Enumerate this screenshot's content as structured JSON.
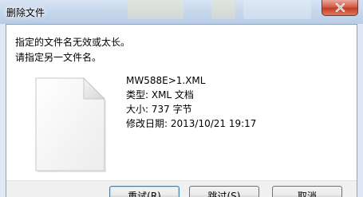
{
  "window": {
    "title": "删除文件",
    "close_icon": "close-icon"
  },
  "message": {
    "line1": "指定的文件名无效或太长。",
    "line2": "请指定另一文件名。"
  },
  "file": {
    "icon": "document-icon",
    "name": "MW588E>1.XML",
    "type": "类型: XML 文档",
    "size": "大小: 737 字节",
    "modified": "修改日期: 2013/10/21 19:17"
  },
  "buttons": {
    "retry": "重试(R)",
    "skip": "跳过(S)",
    "cancel": "取消"
  },
  "colors": {
    "close_button": "#c23a24",
    "titlebar": "#c8d8ec",
    "client_bg": "#ffffff",
    "button_strip": "#f0f0f0"
  }
}
